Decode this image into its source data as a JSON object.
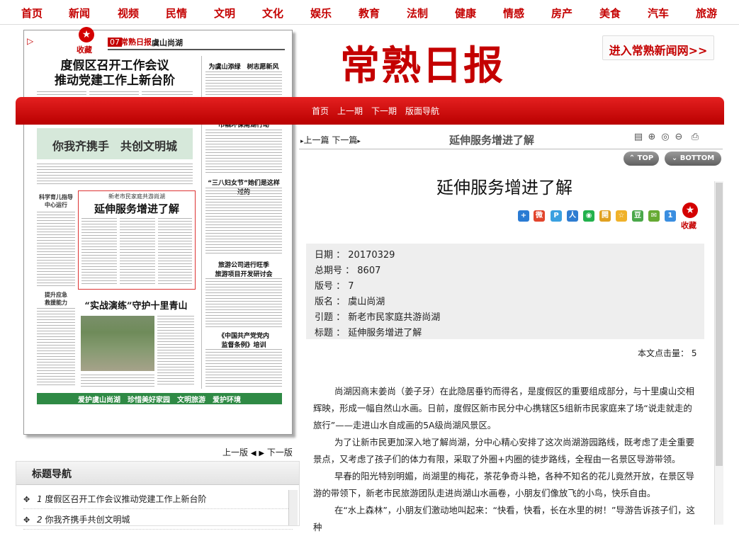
{
  "topnav": [
    "首页",
    "新闻",
    "视频",
    "民情",
    "文明",
    "文化",
    "娱乐",
    "教育",
    "法制",
    "健康",
    "情感",
    "房产",
    "美食",
    "汽车",
    "旅游"
  ],
  "favorite": "收藏",
  "paper": {
    "page_num": "07",
    "logo": "常熟日报",
    "section": "虞山尚湖",
    "headline_lines": [
      "度假区召开工作会议",
      "推动党建工作上新台阶"
    ],
    "band_title": "你我齐携手　共创文明城",
    "hl_kicker": "新老市民家庭共游尚湖",
    "hl_title": "延伸服务增进了解",
    "right_col_titles": [
      "为虞山添绿　树志愿新风",
      "巾帼环保南湖行动",
      "“三八妇女节”她们是这样过的",
      "旅游公司进行旺季\n旅游项目开发研讨会",
      "《中国共产党党内\n监督条例》培训"
    ],
    "left_small_titles": [
      "科学育儿指导\n中心运行",
      "提升应急\n救援能力"
    ],
    "drill_title": "“实战演练”守护十里青山",
    "bottom_band": "爱护虞山尚湖　珍惜美好家园　文明旅游　爱护环境"
  },
  "pager": {
    "prev": "上一版",
    "next": "下一版"
  },
  "title_nav": {
    "heading": "标题导航",
    "items": [
      {
        "num": "1",
        "text": "度假区召开工作会议推动党建工作上新台阶"
      },
      {
        "num": "2",
        "text": "你我齐携手共创文明城"
      }
    ]
  },
  "brand": "常熟日报",
  "enter_button": "进入常熟新闻网>>",
  "redbar": [
    "首页",
    "上一期",
    "下一期",
    "版面导航"
  ],
  "article_nav": {
    "prev_next": "上一篇 下一篇",
    "title": "延伸服务增进了解"
  },
  "scroll_buttons": {
    "top": "TOP",
    "bottom": "BOTTOM"
  },
  "article": {
    "title": "延伸服务增进了解",
    "meta": [
      {
        "label": "日期",
        "value": "20170329"
      },
      {
        "label": "总期号",
        "value": "8607"
      },
      {
        "label": "版号",
        "value": "7"
      },
      {
        "label": "版名",
        "value": "虞山尚湖"
      },
      {
        "label": "引题",
        "value": "新老市民家庭共游尚湖"
      },
      {
        "label": "标题",
        "value": "延伸服务增进了解"
      }
    ],
    "reads_label": "本文点击量：",
    "reads": "5",
    "paragraphs": [
      "尚湖因商末姜尚（姜子牙）在此隐居垂钓而得名，是度假区的重要组成部分，与十里虞山交相辉映，形成一幅自然山水画。日前，度假区新市民分中心携辖区5组新市民家庭来了场“说走就走的旅行”——走进山水自成画的5A级尚湖风景区。",
      "为了让新市民更加深入地了解尚湖，分中心精心安排了这次尚湖游园路线，既考虑了走全重要景点，又考虑了孩子们的体力有限，采取了外圈+内圈的徒步路线，全程由一名景区导游带领。",
      "早春的阳光特别明媚，尚湖里的梅花，茶花争奇斗艳，各种不知名的花儿竟然开放，在景区导游的带领下，新老市民旅游团队走进尚湖山水画卷，小朋友们像放飞的小鸟，快乐自由。",
      "在“水上森林”，小朋友们激动地叫起来：“快看，快看，长在水里的树！”导游告诉孩子们，这种"
    ]
  },
  "colors": {
    "brand_red": "#c40000",
    "bar_red": "#d71a1a",
    "meta_bg": "#eeeeee"
  }
}
